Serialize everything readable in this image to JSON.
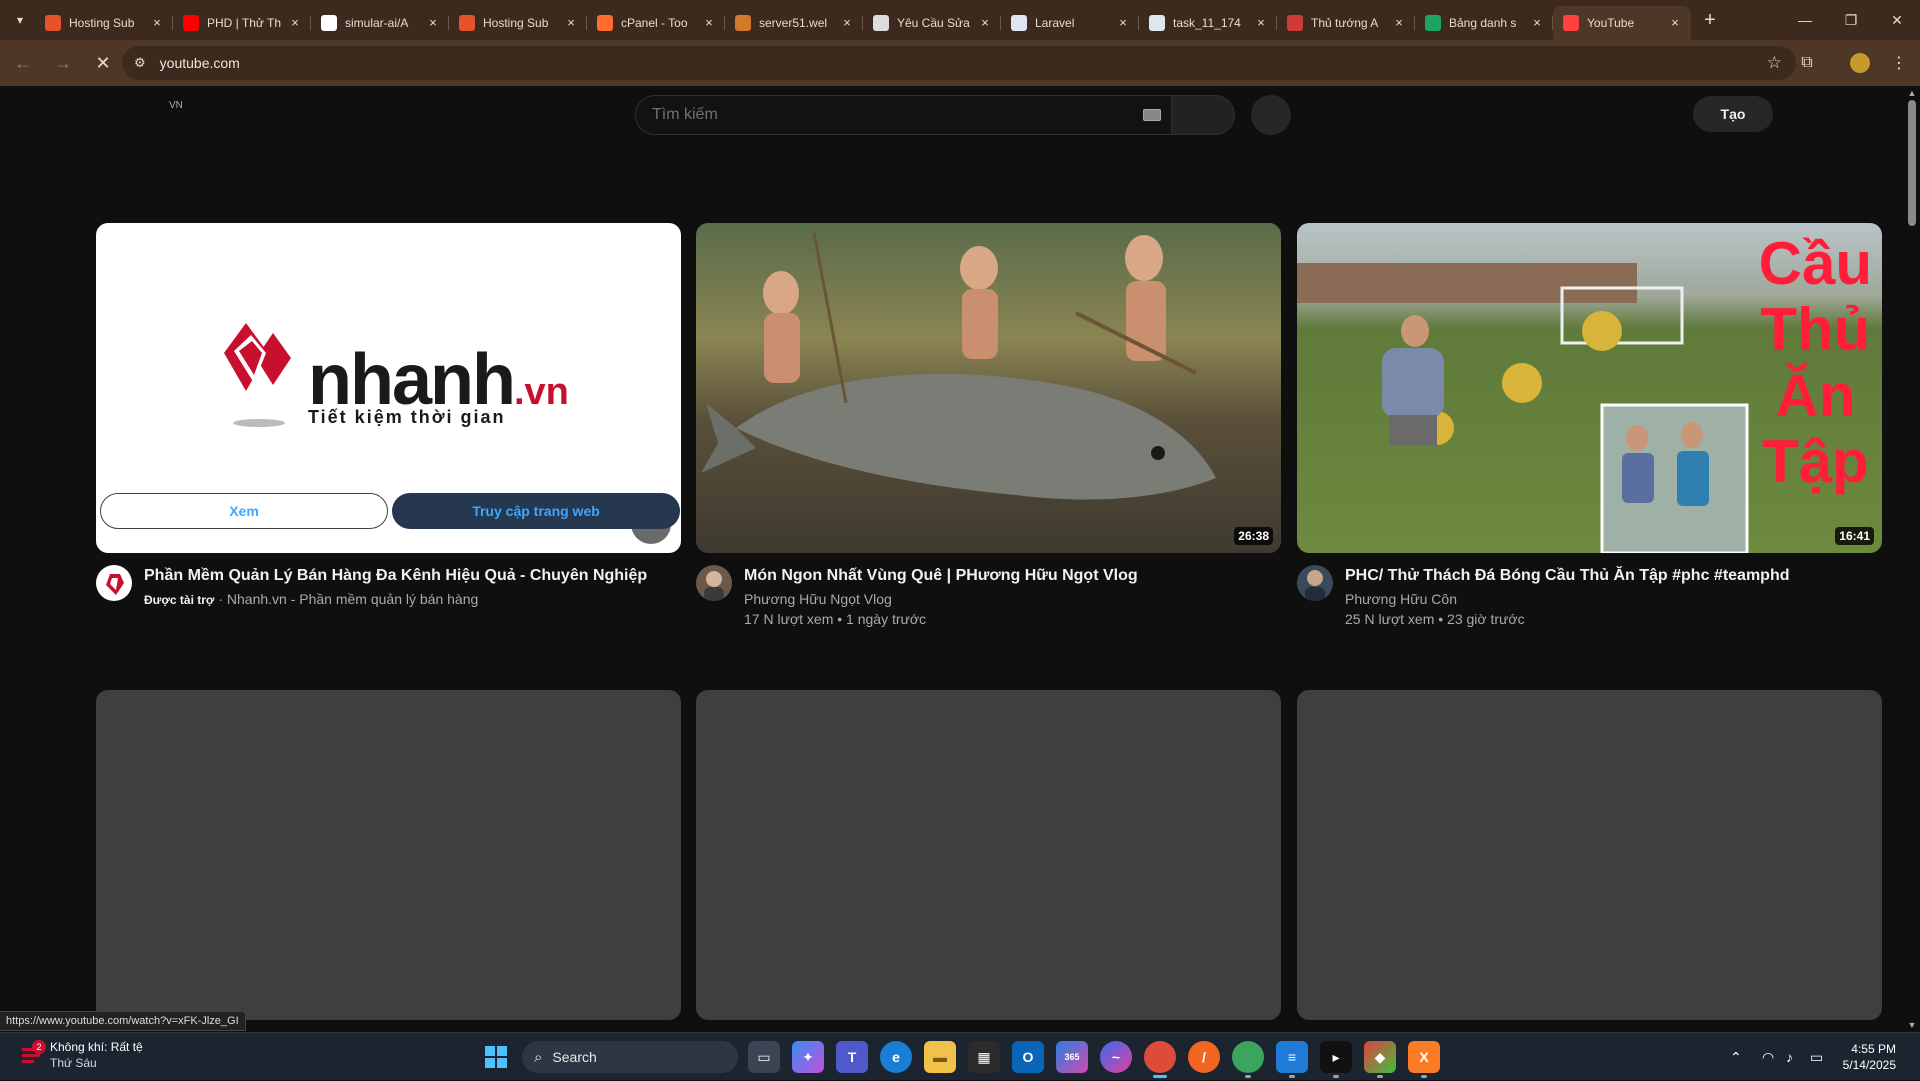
{
  "browser": {
    "tabs": [
      {
        "label": "Hosting Sub",
        "icon": "nhanh-icon",
        "color": "#e6522c"
      },
      {
        "label": "PHD | Thử Th",
        "icon": "youtube-icon",
        "color": "#ff0000"
      },
      {
        "label": "simular-ai/A",
        "icon": "github-icon",
        "color": "#ffffff"
      },
      {
        "label": "Hosting Sub",
        "icon": "nhanh-icon",
        "color": "#e6522c"
      },
      {
        "label": "cPanel - Too",
        "icon": "cpanel-icon",
        "color": "#ff6c2c"
      },
      {
        "label": "server51.wel",
        "icon": "server-icon",
        "color": "#d27a2a"
      },
      {
        "label": "Yêu Cầu Sửa",
        "icon": "link-icon",
        "color": "#dddddd"
      },
      {
        "label": "Laravel",
        "icon": "doc-icon",
        "color": "#dfe6ee"
      },
      {
        "label": "task_11_174",
        "icon": "doc-icon",
        "color": "#dfe6ee"
      },
      {
        "label": "Thủ tướng A",
        "icon": "news-icon",
        "color": "#d03a3a"
      },
      {
        "label": "Bảng danh s",
        "icon": "sheets-icon",
        "color": "#1fa463"
      },
      {
        "label": "YouTube",
        "icon": "loading-icon",
        "color": "#ff4040"
      }
    ],
    "url": "youtube.com",
    "status_url": "https://www.youtube.com/watch?v=xFK-Jlze_GI"
  },
  "youtube": {
    "country": "VN",
    "search_placeholder": "Tìm kiếm",
    "create_label": "Tạo"
  },
  "videos": [
    {
      "title": "Phần Mềm Quản Lý Bán Hàng Đa Kênh Hiệu Quả - Chuyên Nghiệp",
      "sponsored": "Được tài trợ",
      "channel": "Nhanh.vn - Phần mềm quản lý bán hàng",
      "logo_text": "nhanh",
      "logo_suffix": ".vn",
      "slogan": "Tiết kiệm thời gian",
      "button_watch": "Xem",
      "button_visit": "Truy cập trang web"
    },
    {
      "title": "Món Ngon Nhất Vùng Quê | PHương Hữu Ngọt Vlog",
      "channel": "Phương Hữu Ngọt Vlog",
      "stats": "17 N lượt xem • 1 ngày trước",
      "duration": "26:38"
    },
    {
      "title": "PHC/ Thử Thách Đá Bóng Cầu Thủ Ăn Tập #phc #teamphd",
      "channel": "Phương Hữu Côn",
      "stats": "25 N lượt xem • 23 giờ trước",
      "duration": "16:41",
      "overlay_lines": [
        "Cầu",
        "Thủ",
        "Ăn",
        "Tập"
      ]
    }
  ],
  "taskbar": {
    "weather_line1": "Không khí: Rất tệ",
    "weather_line2": "Thứ Sáu",
    "weather_badge": "2",
    "search_label": "Search",
    "time": "4:55 PM",
    "date": "5/14/2025"
  }
}
